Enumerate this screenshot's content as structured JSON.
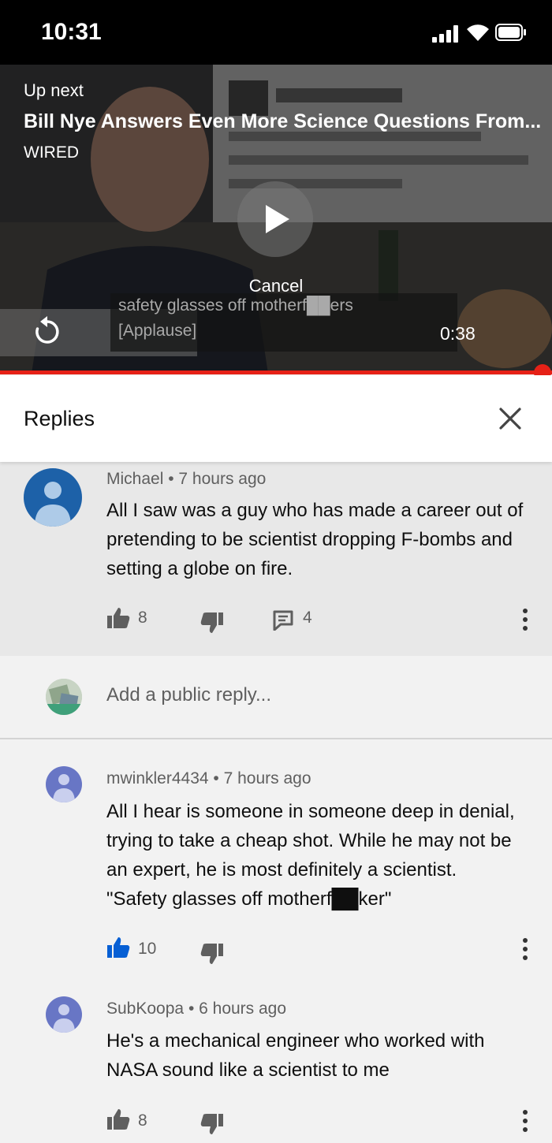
{
  "status_bar": {
    "time": "10:31"
  },
  "player": {
    "up_next_label": "Up next",
    "up_next_title": "Bill Nye Answers Even More Science Questions From...",
    "up_next_channel": "WIRED",
    "cancel_label": "Cancel",
    "captions": [
      "safety glasses off motherf██ers",
      "[Applause]"
    ],
    "countdown_time": "0:38",
    "progress_fraction": 0.97,
    "accent_color": "#e62117"
  },
  "replies_panel": {
    "title": "Replies"
  },
  "parent_comment": {
    "author": "Michael",
    "time": "7 hours ago",
    "text": "All I saw was a guy who has made a career out of pretending to be scientist dropping F-bombs and setting a globe on fire.",
    "likes": "8",
    "reply_count": "4"
  },
  "reply_box": {
    "placeholder": "Add a public reply..."
  },
  "replies": [
    {
      "author": "mwinkler4434",
      "time": "7 hours ago",
      "text": "All I hear is someone in someone deep in denial, trying to take a cheap shot. While he may not be an expert, he is most definitely a scientist. \"Safety glasses off motherf██ker\"",
      "likes": "10",
      "liked": true
    },
    {
      "author": "SubKoopa",
      "time": "6 hours ago",
      "text": "He's a mechanical engineer who worked with NASA sound like a scientist to me",
      "likes": "8",
      "liked": false
    }
  ],
  "icons": {
    "like": "thumb-up-icon",
    "dislike": "thumb-down-icon",
    "reply": "comment-icon",
    "more": "more-vert-icon",
    "close": "close-icon",
    "replay": "replay-icon",
    "play": "play-icon"
  },
  "colors": {
    "liked_blue": "#065fd4",
    "avatar_blue": "#1d61a8",
    "avatar_purple": "#6876c5"
  }
}
